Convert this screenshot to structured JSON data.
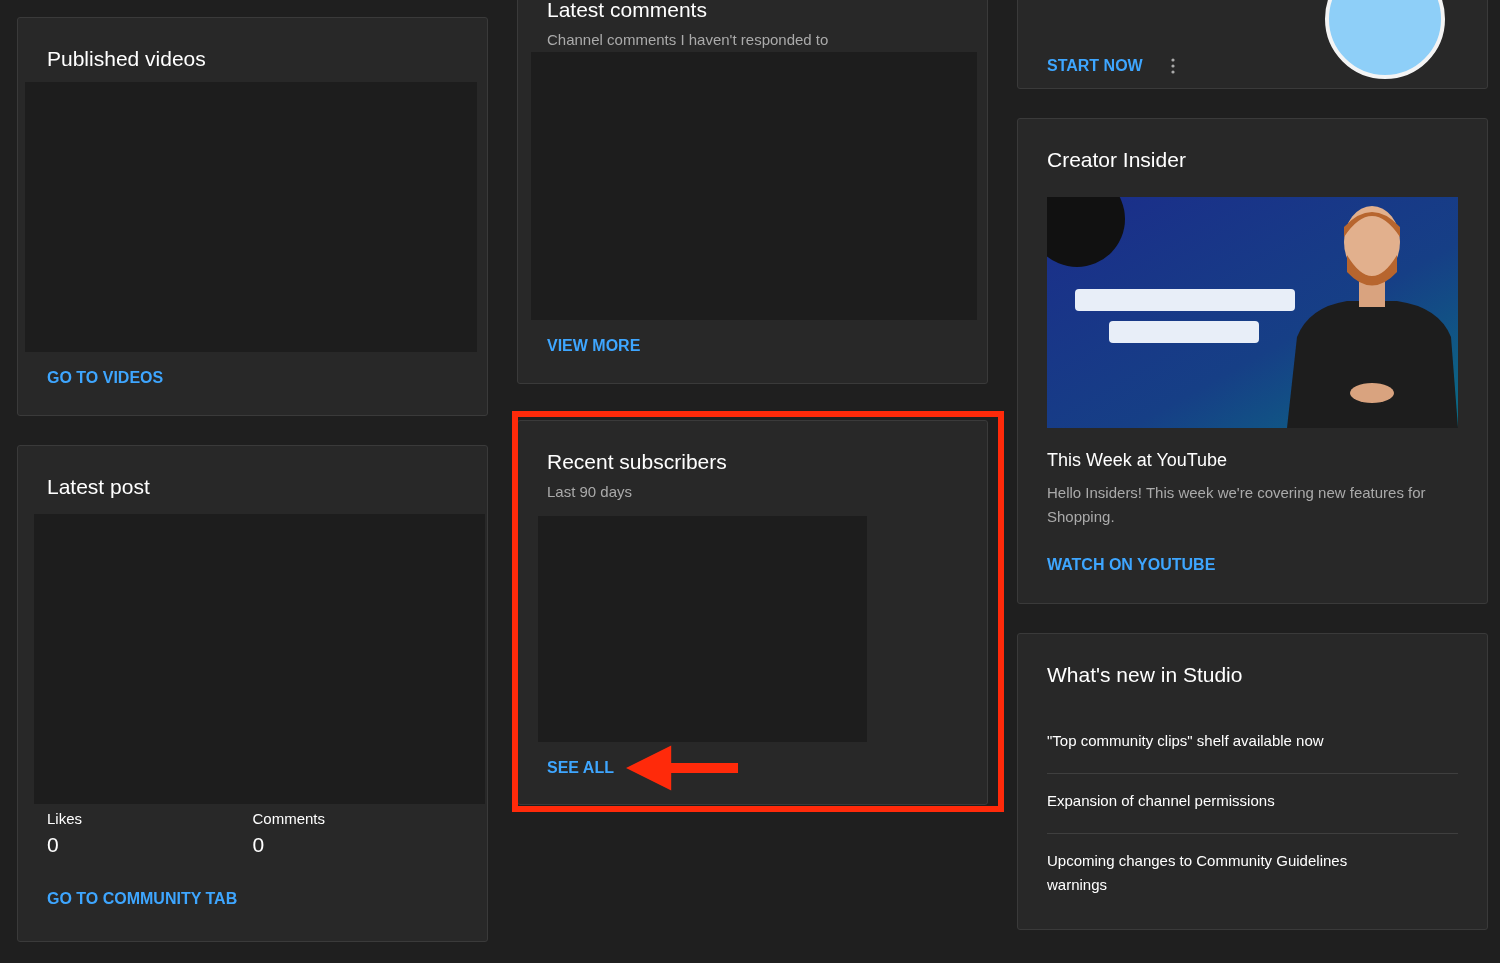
{
  "columns": [
    [
      {
        "kind": "placeholder",
        "title": "Published videos",
        "link": "GO TO VIDEOS",
        "highlighted": false
      },
      {
        "kind": "post",
        "title": "Latest post",
        "stats": [
          {
            "label": "Likes",
            "value": "0"
          },
          {
            "label": "Comments",
            "value": "0"
          }
        ],
        "link": "GO TO COMMUNITY TAB",
        "highlighted": false
      }
    ],
    [
      {
        "kind": "placeholder",
        "title": "Latest comments",
        "subtitle": "Channel comments I haven't responded to",
        "link": "VIEW MORE",
        "highlighted": false
      },
      {
        "kind": "placeholder",
        "title": "Recent subscribers",
        "subtitle": "Last 90 days",
        "link": "SEE ALL",
        "highlighted": true
      }
    ],
    [
      {
        "kind": "promo",
        "link": "START NOW",
        "highlighted": false
      },
      {
        "kind": "video",
        "title": "Creator Insider",
        "video_title": "This Week at YouTube",
        "description": "Hello Insiders! This week we're covering new features for Shopping.",
        "link": "WATCH ON YOUTUBE",
        "highlighted": false
      },
      {
        "kind": "news",
        "title": "What's new in Studio",
        "items": [
          "\"Top community clips\" shelf available now",
          "Expansion of channel permissions",
          "Upcoming changes to Community Guidelines warnings"
        ],
        "highlighted": false
      }
    ]
  ]
}
